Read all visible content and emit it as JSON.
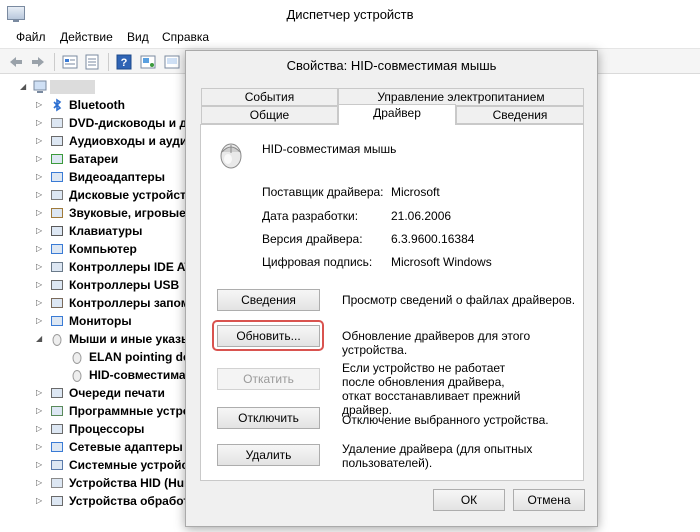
{
  "window": {
    "title": "Диспетчер устройств"
  },
  "menu": [
    "Файл",
    "Действие",
    "Вид",
    "Справка"
  ],
  "tree": {
    "root_label": "",
    "items": [
      {
        "label": "Bluetooth",
        "icon": "bluetooth-icon"
      },
      {
        "label": "DVD-дисководы и д",
        "icon": "dvd-drive-icon"
      },
      {
        "label": "Аудиовходы и аудио",
        "icon": "audio-icon"
      },
      {
        "label": "Батареи",
        "icon": "battery-icon"
      },
      {
        "label": "Видеоадаптеры",
        "icon": "display-adapter-icon"
      },
      {
        "label": "Дисковые устройств",
        "icon": "disk-drive-icon"
      },
      {
        "label": "Звуковые, игровые",
        "icon": "sound-icon"
      },
      {
        "label": "Клавиатуры",
        "icon": "keyboard-icon"
      },
      {
        "label": "Компьютер",
        "icon": "computer-icon"
      },
      {
        "label": "Контроллеры IDE ATA",
        "icon": "ide-controller-icon"
      },
      {
        "label": "Контроллеры USB",
        "icon": "usb-controller-icon"
      },
      {
        "label": "Контроллеры запом",
        "icon": "storage-controller-icon"
      },
      {
        "label": "Мониторы",
        "icon": "monitor-icon"
      },
      {
        "label": "Мыши и иные указы",
        "icon": "mouse-icon",
        "expanded": true
      },
      {
        "label": "ELAN pointing dev",
        "icon": "mouse-icon",
        "child": true
      },
      {
        "label": "HID-совместимая",
        "icon": "mouse-icon",
        "child": true
      },
      {
        "label": "Очереди печати",
        "icon": "print-queue-icon"
      },
      {
        "label": "Программные устро",
        "icon": "software-device-icon"
      },
      {
        "label": "Процессоры",
        "icon": "processor-icon"
      },
      {
        "label": "Сетевые адаптеры",
        "icon": "network-adapter-icon"
      },
      {
        "label": "Системные устройст",
        "icon": "system-device-icon"
      },
      {
        "label": "Устройства HID (Hun",
        "icon": "hid-device-icon"
      },
      {
        "label": "Устройства обработ",
        "icon": "imaging-device-icon"
      }
    ]
  },
  "dialog": {
    "title": "Свойства: HID-совместимая мышь",
    "tabs_top": [
      "События",
      "Управление электропитанием"
    ],
    "tabs_bottom": [
      "Общие",
      "Драйвер",
      "Сведения"
    ],
    "active_tab": "Драйвер",
    "device_name": "HID-совместимая мышь",
    "info": [
      {
        "label": "Поставщик драйвера:",
        "value": "Microsoft"
      },
      {
        "label": "Дата разработки:",
        "value": "21.06.2006"
      },
      {
        "label": "Версия драйвера:",
        "value": "6.3.9600.16384"
      },
      {
        "label": "Цифровая подпись:",
        "value": "Microsoft Windows"
      }
    ],
    "actions": [
      {
        "button": "Сведения",
        "desc": "Просмотр сведений о файлах драйверов.",
        "disabled": false
      },
      {
        "button": "Обновить...",
        "desc": "Обновление драйверов для этого устройства.",
        "disabled": false,
        "highlighted": true
      },
      {
        "button": "Откатить",
        "desc": "Если устройство не работает после обновления драйвера, откат восстанавливает прежний драйвер.",
        "disabled": true
      },
      {
        "button": "Отключить",
        "desc": "Отключение выбранного устройства.",
        "disabled": false
      },
      {
        "button": "Удалить",
        "desc": "Удаление драйвера (для опытных пользователей).",
        "disabled": false
      }
    ],
    "ok_label": "ОК",
    "cancel_label": "Отмена"
  },
  "colors": {
    "highlight": "#d9534f",
    "dialog_bg": "#f0f0f0"
  }
}
